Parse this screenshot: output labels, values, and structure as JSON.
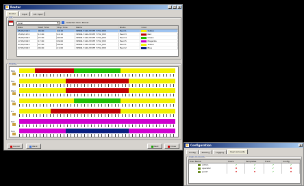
{
  "main": {
    "title": "Router",
    "tabs": [
      "Router",
      "Input",
      "Alt. Input"
    ],
    "list_group": "List",
    "dropdown_value": "local",
    "selected_info": "Selected item: Router",
    "columns": [
      "Date",
      "Start Time",
      "Stop Time",
      "Name",
      "Route",
      "Color"
    ],
    "rows": [
      {
        "date": "05/05/2023",
        "start": "06:00",
        "stop": "04:15",
        "name": "SERIN-7140-STATE 7732_P05",
        "route": "Feed 1",
        "color": "#f2f000",
        "color_name": "Yellow"
      },
      {
        "date": "15/05/1172",
        "start": "13:00",
        "stop": "22:15",
        "name": "SERIN-7140-STATE 7732_P05",
        "route": "Feed 3",
        "color": "#c00000",
        "color_name": "Red"
      },
      {
        "date": "15/05/2023",
        "start": "22:00",
        "stop": "06:00",
        "name": "SERIN-7140-STATE 7732_P05",
        "route": "Feed 4",
        "color": "#20c000",
        "color_name": "Green"
      },
      {
        "date": "17/05/2023",
        "start": "17:00",
        "stop": "09:00",
        "name": "SERIN-7140-STATE 7732_P05",
        "route": "Feed 5",
        "color": "#d000d0",
        "color_name": "Magenta"
      },
      {
        "date": "07/05/2023",
        "start": "07:00",
        "stop": "08:00",
        "name": "SERIN-7140-STATE 7732_P05",
        "route": "Feed 1",
        "color": "#f2f000",
        "color_name": "Yellow"
      },
      {
        "date": "07/05/2023",
        "start": "06:00",
        "stop": "21:00",
        "name": "SERIN-7140-STATE 7732_P05",
        "route": "Feed 2",
        "color": "#0a1e80",
        "color_name": "Blue"
      }
    ],
    "display_group": "Display",
    "days": [
      {
        "label": "Mon",
        "segments": [
          [
            "#f2f000",
            10
          ],
          [
            "#c00000",
            25
          ],
          [
            "#20c000",
            20
          ],
          [
            "#20c000",
            10
          ],
          [
            "#f2f000",
            35
          ]
        ]
      },
      {
        "label": "Tue",
        "segments": [
          [
            "#f2f000",
            30
          ],
          [
            "#c00000",
            40
          ],
          [
            "#f2f000",
            30
          ]
        ]
      },
      {
        "label": "Wed",
        "segments": [
          [
            "#f2f000",
            30
          ],
          [
            "#c00000",
            40
          ],
          [
            "#f2f000",
            30
          ]
        ]
      },
      {
        "label": "Thu",
        "segments": [
          [
            "#f2f000",
            35
          ],
          [
            "#20c000",
            30
          ],
          [
            "#f2f000",
            35
          ]
        ]
      },
      {
        "label": "Fri",
        "segments": [
          [
            "#f2f000",
            20
          ],
          [
            "#c00000",
            45
          ],
          [
            "#f2f000",
            35
          ]
        ]
      },
      {
        "label": "Sat",
        "segments": [
          [
            "#d000d0",
            100
          ]
        ]
      },
      {
        "label": "Sun",
        "segments": [
          [
            "#d000d0",
            30
          ],
          [
            "#0a1e80",
            40
          ],
          [
            "#d000d0",
            30
          ]
        ]
      }
    ],
    "buttons": {
      "cancel": "Cancel",
      "back": "Back",
      "next": "Next",
      "close": "Close"
    }
  },
  "config": {
    "title": "Configuration",
    "tabs": [
      "Config",
      "Routing",
      "Logging",
      "User Accounts"
    ],
    "group_label": "Login Accounts",
    "columns": [
      "User Name",
      "Users",
      "Templates",
      "Track",
      "Config"
    ],
    "users": [
      {
        "name": "admin",
        "perms": [
          true,
          true,
          true,
          true
        ]
      },
      {
        "name": "operator",
        "perms": [
          false,
          true,
          true,
          false
        ]
      },
      {
        "name": "guest",
        "perms": [
          false,
          false,
          true,
          false
        ]
      }
    ]
  }
}
